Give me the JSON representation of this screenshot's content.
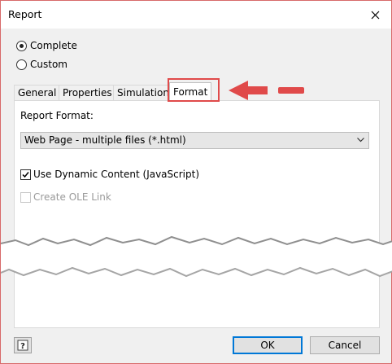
{
  "window": {
    "title": "Report"
  },
  "scope": {
    "options": [
      {
        "label": "Complete",
        "selected": true
      },
      {
        "label": "Custom",
        "selected": false
      }
    ]
  },
  "tabs": [
    {
      "label": "General",
      "active": false
    },
    {
      "label": "Properties",
      "active": false
    },
    {
      "label": "Simulations",
      "active": false
    },
    {
      "label": "Format",
      "active": true
    }
  ],
  "format": {
    "report_format_label": "Report Format:",
    "report_format_value": "Web Page - multiple files (*.html)",
    "dynamic_content": {
      "label": "Use Dynamic Content (JavaScript)",
      "checked": true,
      "enabled": true
    },
    "ole_link": {
      "label": "Create OLE Link",
      "checked": false,
      "enabled": false
    }
  },
  "footer": {
    "help_icon": "help-icon",
    "ok_label": "OK",
    "cancel_label": "Cancel"
  },
  "colors": {
    "annotation_red": "#e04a4a",
    "accent_blue": "#0078d7"
  }
}
